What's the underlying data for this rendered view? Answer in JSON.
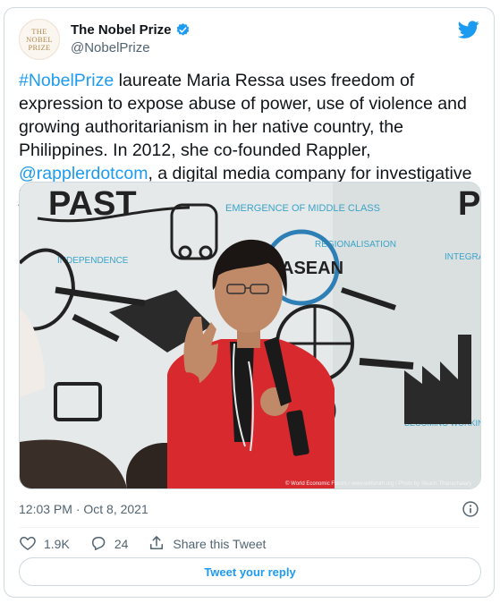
{
  "author": {
    "display_name": "The Nobel Prize",
    "handle": "@NobelPrize",
    "avatar_lines": [
      "THE",
      "NOBEL",
      "PRIZE"
    ],
    "verified": true
  },
  "tweet": {
    "hashtag": "#NobelPrize",
    "text_part1": " laureate Maria Ressa uses freedom of expression to expose abuse of power, use of violence and growing authoritarianism in her native country, the Philippines. In 2012, she co-founded Rappler, ",
    "mention": "@rapplerdotcom",
    "text_part2": ", a digital media company for investigative journalism."
  },
  "media": {
    "whiteboard_words": {
      "past_left": "PAST",
      "p_right": "P",
      "independence": "INDEPENDENCE",
      "emergence": "EMERGENCE OF MIDDLE CLASS",
      "asean": "ASEAN",
      "regionalisation": "REGIONALISATION",
      "integration": "INTEGRATION",
      "becoming_working": "BECOMING WORKING CONDITION"
    },
    "photo_credit": "© World Economic Forum / www.weforum.org / Photo by Sikarin Thanachaiary"
  },
  "meta": {
    "timestamp": "12:03 PM · Oct 8, 2021"
  },
  "actions": {
    "likes": "1.9K",
    "replies": "24",
    "share_label": "Share this Tweet"
  },
  "reply_button": "Tweet your reply",
  "colors": {
    "accent": "#1d9bf0",
    "jacket": "#d8292f",
    "border": "#cfd9de",
    "muted_text": "#536471"
  }
}
